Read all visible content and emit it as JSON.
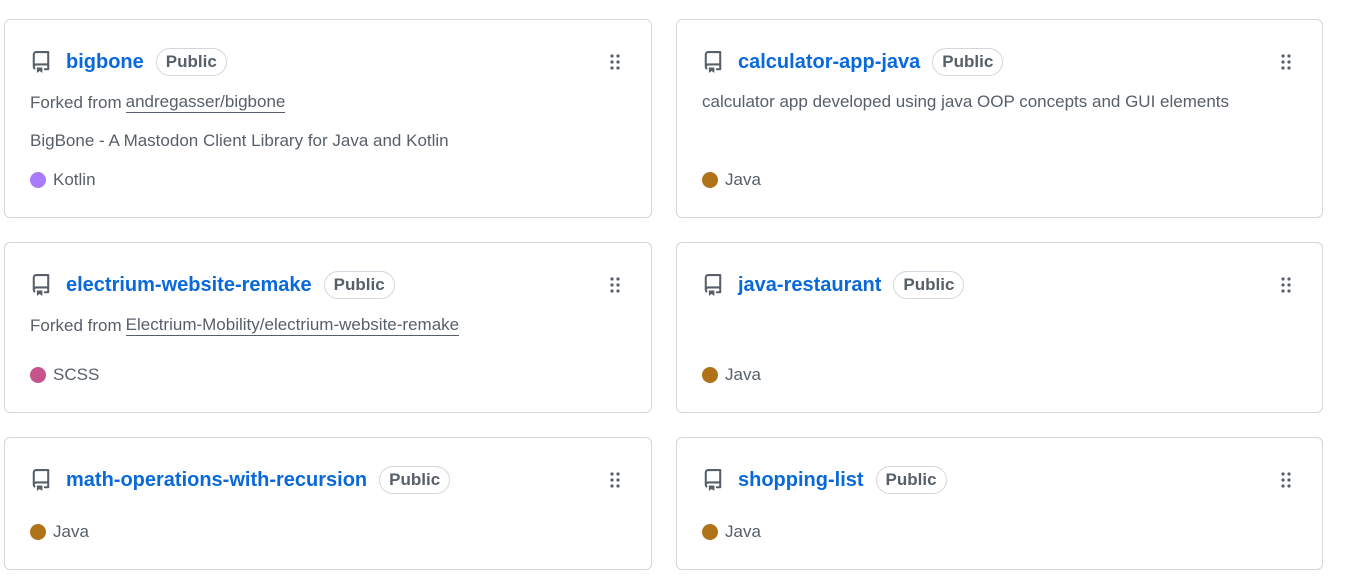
{
  "repos": [
    {
      "name": "bigbone",
      "visibility": "Public",
      "fork_prefix": "Forked from",
      "fork_source": "andregasser/bigbone",
      "description": "BigBone - A Mastodon Client Library for Java and Kotlin",
      "language": "Kotlin",
      "language_color": "#A97BFF"
    },
    {
      "name": "calculator-app-java",
      "visibility": "Public",
      "description": "calculator app developed using java OOP concepts and GUI elements",
      "language": "Java",
      "language_color": "#b07219"
    },
    {
      "name": "electrium-website-remake",
      "visibility": "Public",
      "fork_prefix": "Forked from",
      "fork_source": "Electrium-Mobility/electrium-website-remake",
      "language": "SCSS",
      "language_color": "#c6538c"
    },
    {
      "name": "java-restaurant",
      "visibility": "Public",
      "language": "Java",
      "language_color": "#b07219"
    },
    {
      "name": "math-operations-with-recursion",
      "visibility": "Public",
      "language": "Java",
      "language_color": "#b07219"
    },
    {
      "name": "shopping-list",
      "visibility": "Public",
      "language": "Java",
      "language_color": "#b07219"
    }
  ]
}
